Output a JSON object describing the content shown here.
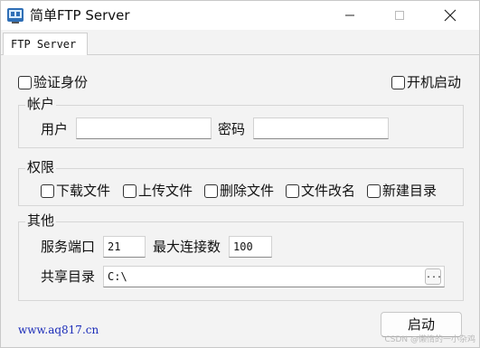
{
  "window": {
    "title": "简单FTP Server",
    "tab_label": "FTP Server"
  },
  "options": {
    "verify_identity": {
      "label": "验证身份",
      "checked": false
    },
    "autostart": {
      "label": "开机启动",
      "checked": false
    }
  },
  "account": {
    "title": "帐户",
    "user_label": "用户",
    "user_value": "",
    "password_label": "密码",
    "password_value": ""
  },
  "permissions": {
    "title": "权限",
    "items": [
      {
        "label": "下载文件",
        "checked": false
      },
      {
        "label": "上传文件",
        "checked": false
      },
      {
        "label": "删除文件",
        "checked": false
      },
      {
        "label": "文件改名",
        "checked": false
      },
      {
        "label": "新建目录",
        "checked": false
      }
    ]
  },
  "other": {
    "title": "其他",
    "port_label": "服务端口",
    "port_value": "21",
    "max_conn_label": "最大连接数",
    "max_conn_value": "100",
    "share_dir_label": "共享目录",
    "share_dir_value": "C:\\",
    "browse_label": "..."
  },
  "footer": {
    "link": "www.aq817.cn",
    "start_label": "启动",
    "watermark": "CSDN @懒惰的一小杂鸡"
  }
}
